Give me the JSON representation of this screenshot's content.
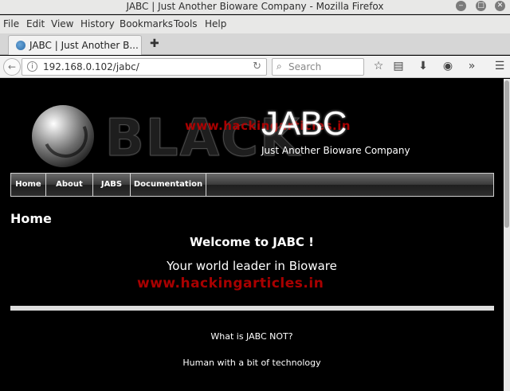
{
  "window": {
    "title": "JABC | Just Another Bioware Company - Mozilla Firefox"
  },
  "menu": [
    "File",
    "Edit",
    "View",
    "History",
    "Bookmarks",
    "Tools",
    "Help"
  ],
  "tab": {
    "label": "JABC | Just Another B..."
  },
  "navbar": {
    "url": "192.168.0.102/jabc/",
    "search_placeholder": "Search"
  },
  "site": {
    "logo_word": "BLACK",
    "title": "JABC",
    "subtitle": "Just Another Bioware Company",
    "nav": [
      "Home",
      "About",
      "JABS",
      "Documentation"
    ]
  },
  "content": {
    "heading": "Home",
    "welcome": "Welcome to JABC !",
    "tagline": "Your world leader in Bioware",
    "question": "What is JABC NOT?",
    "answer": "Human with a bit of technology"
  },
  "watermark": "www.hackingarticles.in"
}
